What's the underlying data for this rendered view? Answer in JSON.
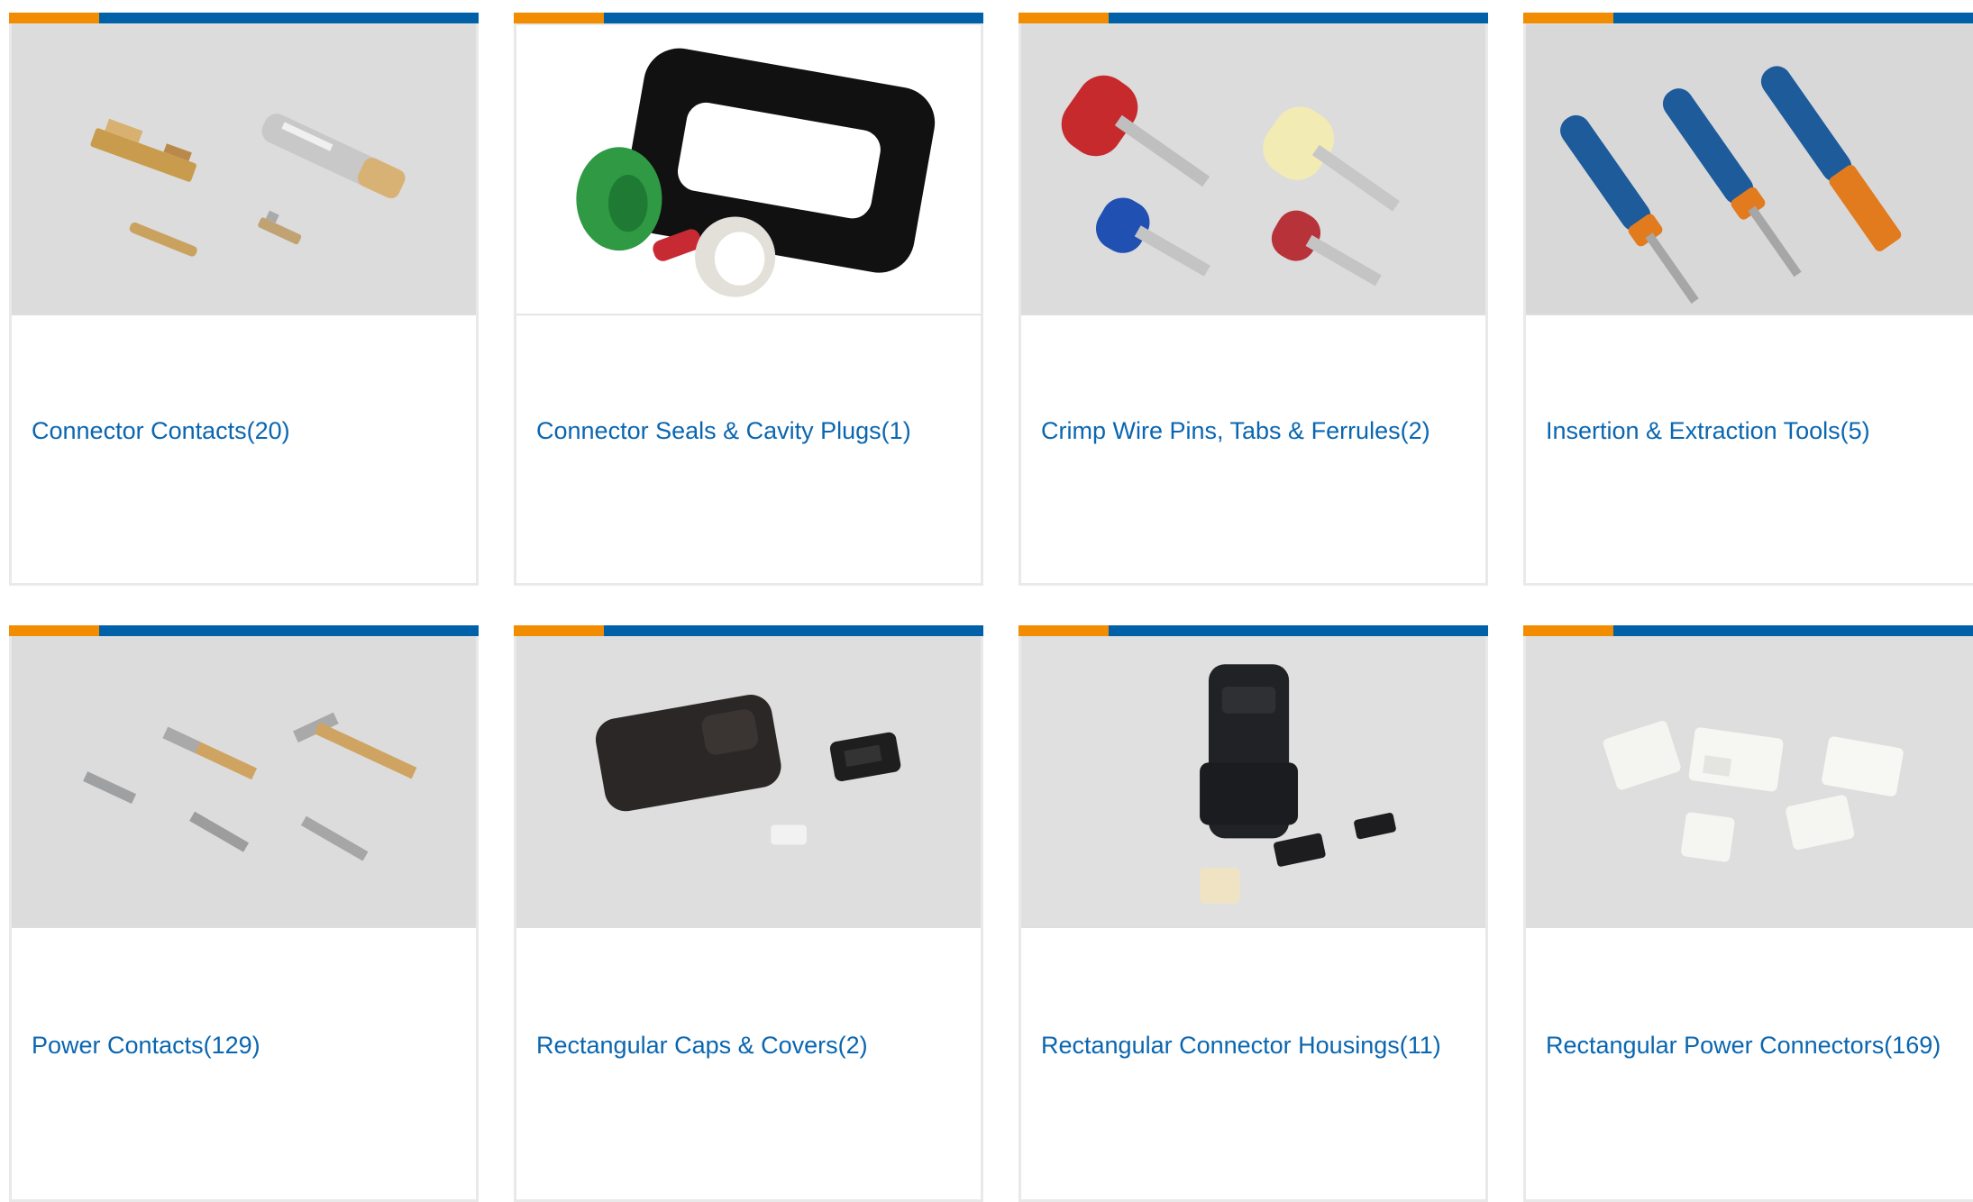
{
  "colors": {
    "accent_orange": "#f28c00",
    "accent_blue": "#0061a8",
    "link": "#0a66b0",
    "border": "#e9e9e9"
  },
  "categories": [
    {
      "label": "Connector Contacts(20)",
      "image": "connector-contacts-image"
    },
    {
      "label": "Connector Seals & Cavity Plugs(1)",
      "image": "connector-seals-image"
    },
    {
      "label": "Crimp Wire Pins, Tabs & Ferrules(2)",
      "image": "crimp-wire-pins-image"
    },
    {
      "label": "Insertion & Extraction Tools(5)",
      "image": "insertion-extraction-tools-image"
    },
    {
      "label": "Power Contacts(129)",
      "image": "power-contacts-image"
    },
    {
      "label": "Rectangular Caps & Covers(2)",
      "image": "rectangular-caps-image"
    },
    {
      "label": "Rectangular Connector Housings(11)",
      "image": "rectangular-housings-image"
    },
    {
      "label": "Rectangular Power Connectors(169)",
      "image": "rectangular-power-connectors-image"
    }
  ]
}
